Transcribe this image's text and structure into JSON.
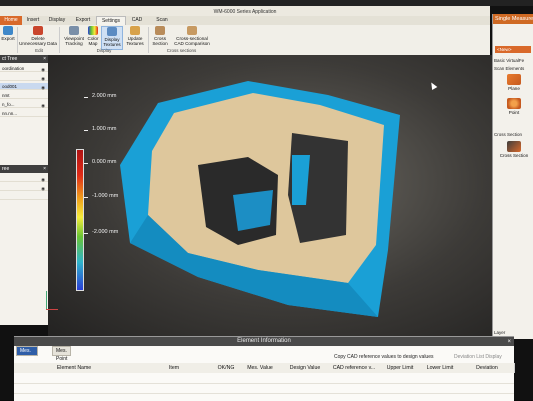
{
  "window": {
    "title": "WM-6000 Series Application"
  },
  "tabs": [
    {
      "label": "Home"
    },
    {
      "label": "Insert"
    },
    {
      "label": "Display"
    },
    {
      "label": "Export"
    },
    {
      "label": "Settings"
    },
    {
      "label": "CAD"
    },
    {
      "label": "Scan"
    }
  ],
  "ribbon": {
    "buttons": [
      {
        "label": "Export"
      },
      {
        "label": "Delete Unnecessary Data"
      },
      {
        "label": "Viewpoint Tracking"
      },
      {
        "label": "Color Map"
      },
      {
        "label": "Display Textures"
      },
      {
        "label": "Update Textures"
      },
      {
        "label": "Cross Section"
      },
      {
        "label": "Cross-sectional CAD Comparison"
      }
    ],
    "groups": [
      {
        "label": "Edit"
      },
      {
        "label": "Display"
      },
      {
        "label": "Cross sections"
      }
    ]
  },
  "left_panel": {
    "tree_title": "ct Tree",
    "tree_rows": [
      {
        "label": "oordination"
      },
      {
        "label": "ood001"
      },
      {
        "label": "nmt"
      },
      {
        "label": "n_fo..."
      },
      {
        "label": "nn.nn..."
      }
    ],
    "lower_title": "ree"
  },
  "color_scale": {
    "labels": [
      "2.000 mm",
      "1.000 mm",
      "0.000 mm",
      "-1.000 mm",
      "-2.000 mm"
    ],
    "colors": {
      "high": "#b01313",
      "mid": "#f5ec3c",
      "low": "#2a3fd6"
    }
  },
  "right_panel": {
    "title": "Single Measure",
    "new_label": "<New>",
    "sub_tabs": "Basic   VirtualFe",
    "scan_elements_label": "Scan Elements",
    "items": [
      {
        "label": "Plane"
      },
      {
        "label": "Point"
      }
    ],
    "cross_section_label": "Cross Section",
    "cross_item": "Cross Section",
    "layer_label": "Layer"
  },
  "element_info": {
    "title": "Element Information",
    "tabs": [
      {
        "label": "Mes. Result"
      },
      {
        "label": "Mes. Point"
      }
    ],
    "copy_button": "Copy CAD reference values to design values",
    "deviation_display": "Deviation List Display",
    "columns": [
      "Element Name",
      "Item",
      "OK/NG",
      "Mes. Value",
      "Design Value",
      "CAD reference v...",
      "Upper Limit",
      "Lower Limit",
      "Deviation"
    ]
  }
}
